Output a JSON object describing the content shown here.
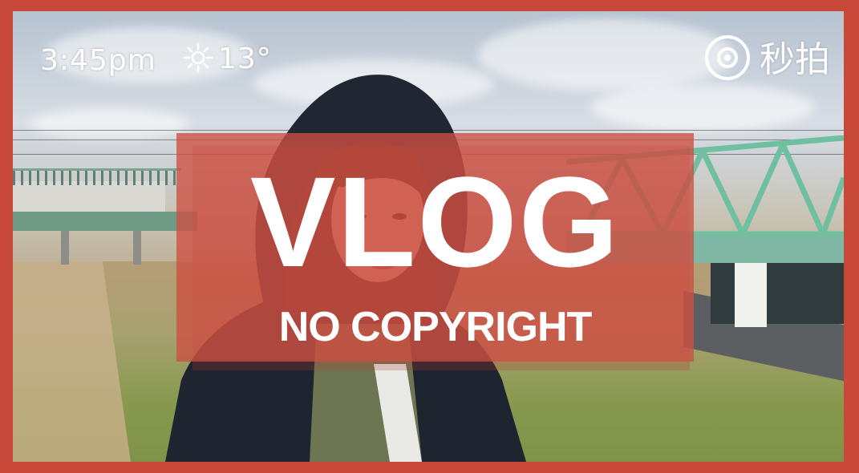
{
  "hud": {
    "time": "3:45pm",
    "weather_icon": "sun-icon",
    "temperature": "13°"
  },
  "watermark": {
    "icon": "camera-logo-icon",
    "text": "秒拍"
  },
  "cover": {
    "title": "VLOG",
    "subtitle": "NO COPYRIGHT",
    "overlay_color": "#cd5042",
    "frame_color": "#c8483a"
  }
}
